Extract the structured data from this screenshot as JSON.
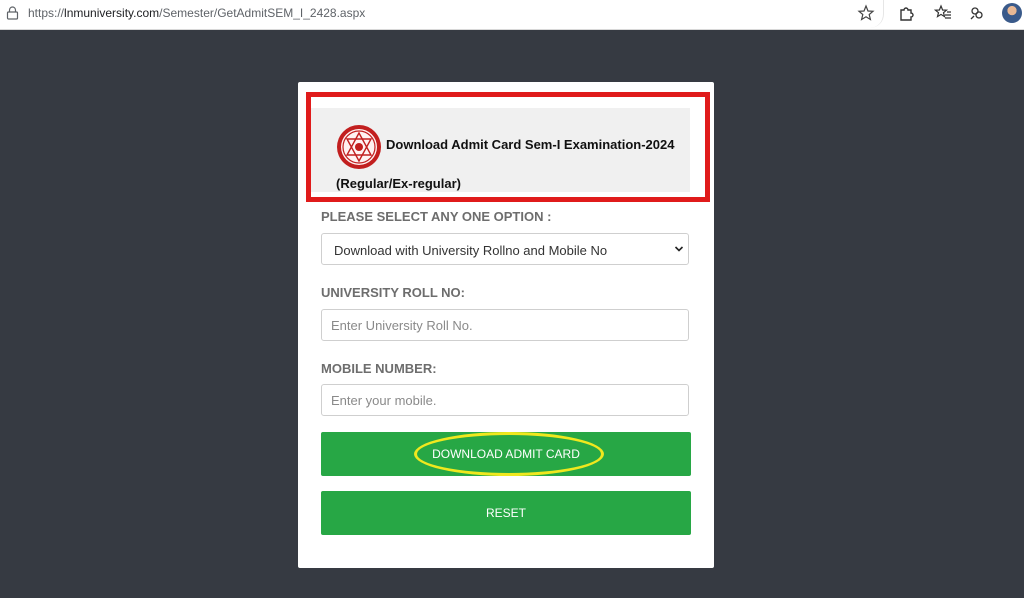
{
  "browser": {
    "url_prefix": "https://",
    "url_domain": "lnmuniversity.com",
    "url_path": "/Semester/GetAdmitSEM_I_2428.aspx",
    "icons": [
      "lock-icon",
      "star-icon",
      "extensions-icon",
      "favorites-icon",
      "collections-icon",
      "profile-avatar"
    ]
  },
  "header": {
    "title": "Download Admit Card Sem-I Examination-2024",
    "subtitle": "(Regular/Ex-regular)"
  },
  "form": {
    "option_label": "PLEASE SELECT ANY ONE OPTION :",
    "option_selected": "Download with University Rollno and Mobile No",
    "roll_label": "UNIVERSITY ROLL NO:",
    "roll_placeholder": "Enter University Roll No.",
    "mobile_label": "MOBILE NUMBER:",
    "mobile_placeholder": "Enter your mobile.",
    "download_label": "DOWNLOAD ADMIT CARD",
    "reset_label": "RESET"
  },
  "colors": {
    "page_bg": "#363a42",
    "button_green": "#27a745",
    "highlight_red": "#e01b1b",
    "highlight_yellow": "#f0e81e"
  }
}
